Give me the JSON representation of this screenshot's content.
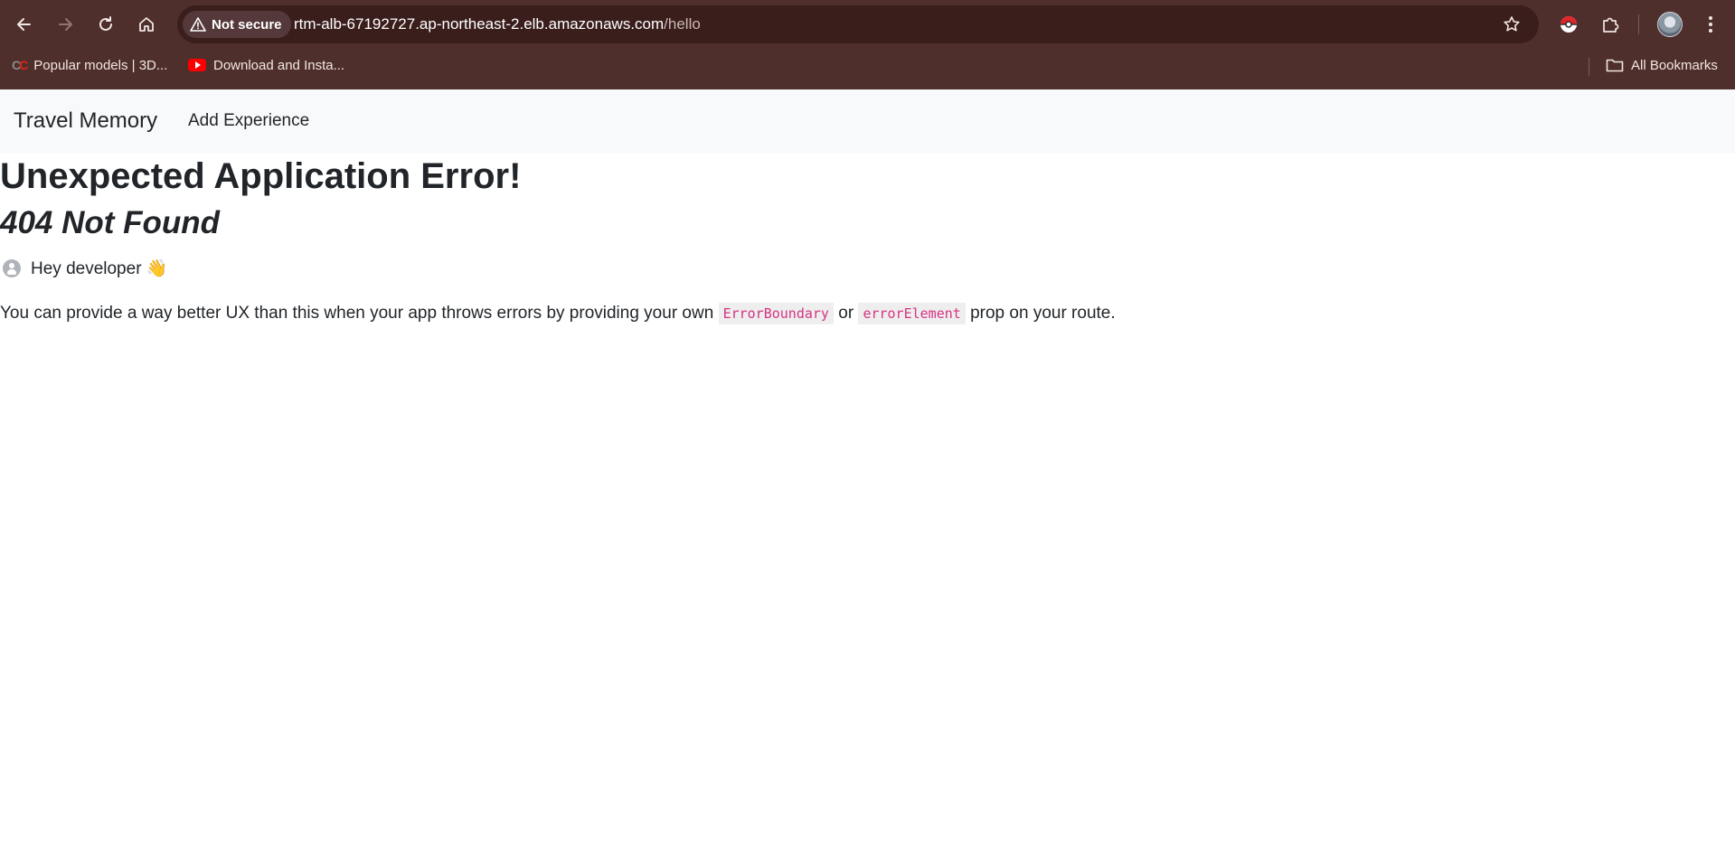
{
  "browser": {
    "security_label": "Not secure",
    "url_host": "rtm-alb-67192727.ap-northeast-2.elb.amazonaws.com",
    "url_path": "/hello",
    "bookmarks": [
      {
        "label": "Popular models | 3D...",
        "icon": "cc-logo-icon"
      },
      {
        "label": "Download and Insta...",
        "icon": "youtube-icon"
      }
    ],
    "all_bookmarks_label": "All Bookmarks",
    "colors": {
      "frame": "#4f2f2c",
      "omnibox": "#3a1e1c"
    }
  },
  "app": {
    "brand": "Travel Memory",
    "nav_links": [
      "Add Experience"
    ]
  },
  "error": {
    "title": "Unexpected Application Error!",
    "subtitle": "404 Not Found",
    "dev_greeting": "Hey developer",
    "dev_emoji": "👋",
    "message_before": "You can provide a way better UX than this when your app throws errors by providing your own",
    "code1": "ErrorBoundary",
    "message_mid": "or",
    "code2": "errorElement",
    "message_after": "prop on your route.",
    "code_color": "#d63384"
  }
}
